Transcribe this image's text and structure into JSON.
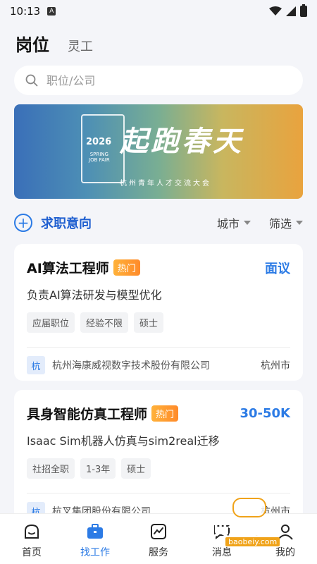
{
  "status_bar": {
    "time": "10:13",
    "badge": "A"
  },
  "top_tabs": {
    "active": "岗位",
    "inactive": "灵工"
  },
  "search": {
    "placeholder": "职位/公司"
  },
  "banner": {
    "year": "2026",
    "spring_line1": "SPRING",
    "spring_line2": "JOB FAIR",
    "title": "起跑春天",
    "subtitle": "杭州青年人才交流大会"
  },
  "intent": {
    "label": "求职意向",
    "filter_city": "城市",
    "filter_screen": "筛选"
  },
  "jobs": [
    {
      "title": "AI算法工程师",
      "badge": "热门",
      "salary": "面议",
      "desc": "负责AI算法研发与模型优化",
      "tags": [
        "应届职位",
        "经验不限",
        "硕士"
      ],
      "company_logo": "杭",
      "company": "杭州海康威视数字技术股份有限公司",
      "city": "杭州市"
    },
    {
      "title": "具身智能仿真工程师",
      "badge": "热门",
      "salary": "30-50K",
      "desc": "Isaac Sim机器人仿真与sim2real迁移",
      "tags": [
        "社招全职",
        "1-3年",
        "硕士"
      ],
      "company_logo": "杭",
      "company": "杭叉集团股份有限公司",
      "city": "杭州市"
    }
  ],
  "bottom_nav": [
    {
      "label": "首页",
      "icon": "home-icon"
    },
    {
      "label": "找工作",
      "icon": "briefcase-icon"
    },
    {
      "label": "服务",
      "icon": "chart-icon"
    },
    {
      "label": "消息",
      "icon": "chat-icon"
    },
    {
      "label": "我的",
      "icon": "user-icon"
    }
  ],
  "watermark": {
    "main": "宝贝游戏网",
    "url": "baobeiy.com"
  },
  "colors": {
    "accent": "#2c7be5",
    "hot": "#ff9a2e",
    "background": "#f4f5f9"
  }
}
